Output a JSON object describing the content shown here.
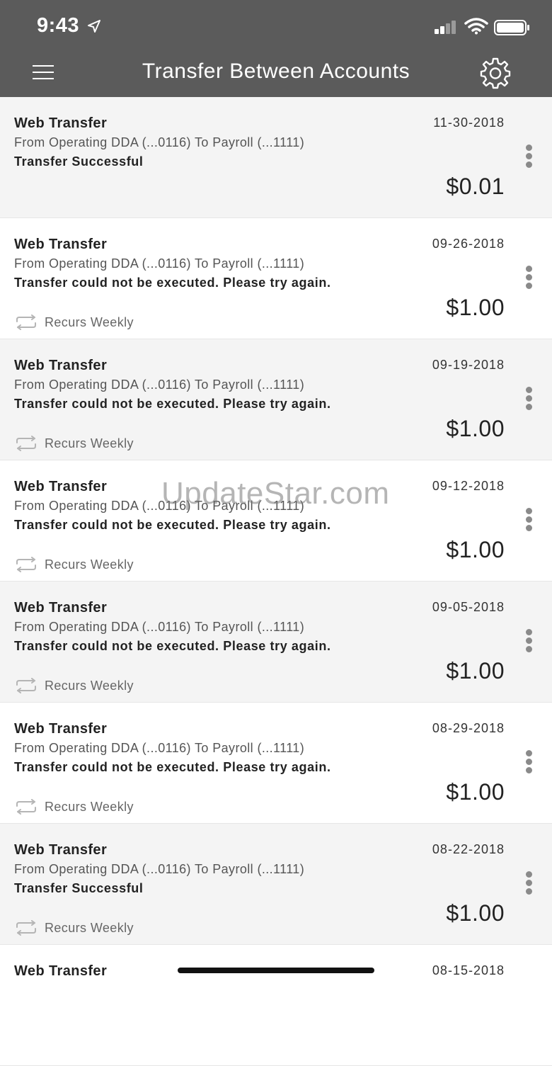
{
  "status_bar": {
    "time": "9:43"
  },
  "header": {
    "title": "Transfer Between Accounts"
  },
  "transfers": [
    {
      "title": "Web Transfer",
      "date": "11-30-2018",
      "route": "From Operating DDA (...0116) To Payroll (...1111)",
      "status": "Transfer Successful",
      "amount": "$0.01",
      "recurrence": ""
    },
    {
      "title": "Web Transfer",
      "date": "09-26-2018",
      "route": "From Operating DDA (...0116) To Payroll (...1111)",
      "status": "Transfer could not be executed. Please try again.",
      "amount": "$1.00",
      "recurrence": "Recurs Weekly"
    },
    {
      "title": "Web Transfer",
      "date": "09-19-2018",
      "route": "From Operating DDA (...0116) To Payroll (...1111)",
      "status": "Transfer could not be executed. Please try again.",
      "amount": "$1.00",
      "recurrence": "Recurs Weekly"
    },
    {
      "title": "Web Transfer",
      "date": "09-12-2018",
      "route": "From Operating DDA (...0116) To Payroll (...1111)",
      "status": "Transfer could not be executed. Please try again.",
      "amount": "$1.00",
      "recurrence": "Recurs Weekly"
    },
    {
      "title": "Web Transfer",
      "date": "09-05-2018",
      "route": "From Operating DDA (...0116) To Payroll (...1111)",
      "status": "Transfer could not be executed. Please try again.",
      "amount": "$1.00",
      "recurrence": "Recurs Weekly"
    },
    {
      "title": "Web Transfer",
      "date": "08-29-2018",
      "route": "From Operating DDA (...0116) To Payroll (...1111)",
      "status": "Transfer could not be executed. Please try again.",
      "amount": "$1.00",
      "recurrence": "Recurs Weekly"
    },
    {
      "title": "Web Transfer",
      "date": "08-22-2018",
      "route": "From Operating DDA (...0116) To Payroll (...1111)",
      "status": "Transfer Successful",
      "amount": "$1.00",
      "recurrence": "Recurs Weekly"
    },
    {
      "title": "Web Transfer",
      "date": "08-15-2018",
      "route": "",
      "status": "",
      "amount": "",
      "recurrence": ""
    }
  ],
  "watermark": "UpdateStar.com",
  "icons": {
    "menu": "hamburger-menu-icon",
    "settings": "gear-icon",
    "recurrence": "repeat-icon",
    "more": "kebab-icon"
  },
  "colors": {
    "header_bg": "#5b5b5b",
    "row_light": "#f4f4f4",
    "row_white": "#ffffff"
  }
}
